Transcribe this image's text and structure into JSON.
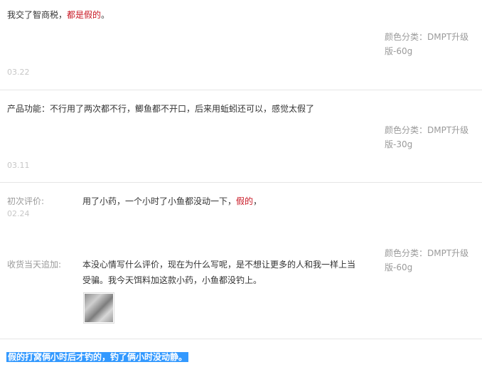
{
  "reviews": [
    {
      "text_normal": "我交了智商税，",
      "text_red": "都是假的",
      "text_end": "。",
      "variant_line1": "颜色分类：DMPT升级",
      "variant_line2": "版-60g",
      "date": "03.22"
    },
    {
      "text": "产品功能：不行用了两次都不行，鲫鱼都不开口，后来用蚯蚓还可以，感觉太假了",
      "variant_line1": "颜色分类：DMPT升级",
      "variant_line2": "版-30g",
      "date": "03.11"
    },
    {
      "initial_label": "初次评价:",
      "initial_date": "02.24",
      "initial_text_normal": "用了小药，一个小时了小鱼都没动一下，",
      "initial_text_red": "假的",
      "initial_text_end": "，",
      "followup_label": "收货当天追加:",
      "followup_line1": "本没心情写什么评价，现在为什么写呢，是不想让更多的人和我一样上当",
      "followup_line2": "受骗。我今天饵料加这款小药，小鱼都没钓上。",
      "variant_line1": "颜色分类：DMPT升级",
      "variant_line2": "版-60g"
    }
  ],
  "selected_text": "假的打窝俩小时后才钓的，钓了俩小时没动静。"
}
